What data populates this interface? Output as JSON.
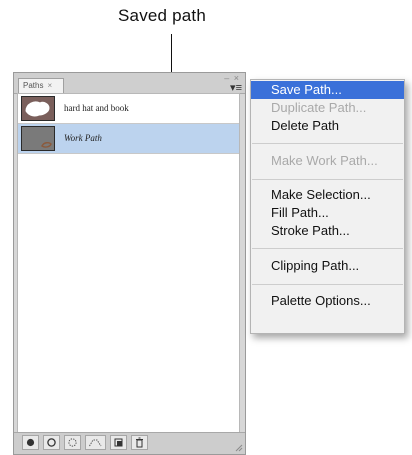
{
  "callout": {
    "label": "Saved path"
  },
  "panel": {
    "tab_label": "Paths",
    "tab_close_glyph": "×",
    "window_controls_glyph": "– ×",
    "menu_button_glyph": "▾≡",
    "rows": [
      {
        "label": "hard hat and book",
        "selected": false
      },
      {
        "label": "Work Path",
        "selected": true
      }
    ],
    "bottom_buttons": [
      "fill-path-icon",
      "stroke-path-icon",
      "load-selection-icon",
      "make-work-path-icon",
      "new-path-icon",
      "delete-path-icon"
    ]
  },
  "menu": {
    "items": [
      {
        "label": "Save Path...",
        "state": "highlighted"
      },
      {
        "label": "Duplicate Path...",
        "state": "disabled"
      },
      {
        "label": "Delete Path",
        "state": "enabled"
      },
      {
        "label": "Make Work Path...",
        "state": "disabled"
      },
      {
        "label": "Make Selection...",
        "state": "enabled"
      },
      {
        "label": "Fill Path...",
        "state": "enabled"
      },
      {
        "label": "Stroke Path...",
        "state": "enabled"
      },
      {
        "label": "Clipping Path...",
        "state": "enabled"
      },
      {
        "label": "Palette Options...",
        "state": "enabled"
      }
    ]
  },
  "colors": {
    "highlight": "#3a70d9",
    "selected_row": "#bcd3ee",
    "disabled_text": "#a9a9a9"
  }
}
